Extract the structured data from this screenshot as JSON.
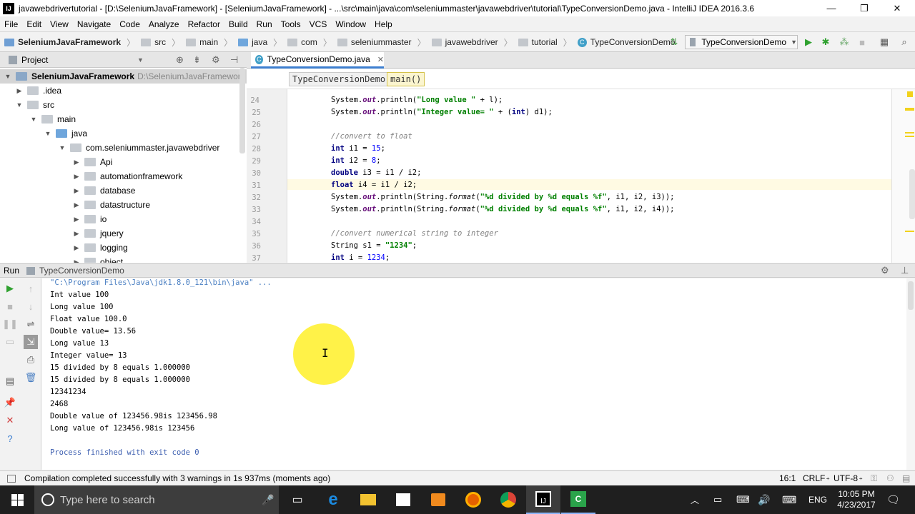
{
  "window": {
    "title": "javawebdrivertutorial - [D:\\SeleniumJavaFramework] - [SeleniumJavaFramework] - ...\\src\\main\\java\\com\\seleniummaster\\javawebdriver\\tutorial\\TypeConversionDemo.java - IntelliJ IDEA 2016.3.6",
    "app_icon_text": "IJ",
    "minimize": "—",
    "restore": "❐",
    "close": "✕"
  },
  "menu": [
    "File",
    "Edit",
    "View",
    "Navigate",
    "Code",
    "Analyze",
    "Refactor",
    "Build",
    "Run",
    "Tools",
    "VCS",
    "Window",
    "Help"
  ],
  "navbar": {
    "crumbs": [
      "SeleniumJavaFramework",
      "src",
      "main",
      "java",
      "com",
      "seleniummaster",
      "javawebdriver",
      "tutorial",
      "TypeConversionDemo"
    ],
    "run_config": "TypeConversionDemo"
  },
  "project_panel": {
    "title": "Project",
    "tree": [
      {
        "label": "SeleniumJavaFramework",
        "path": "D:\\SeleniumJavaFramework",
        "depth": 0,
        "expanded": true,
        "icon": "module"
      },
      {
        "label": ".idea",
        "depth": 1,
        "expanded": false,
        "icon": "folder"
      },
      {
        "label": "src",
        "depth": 1,
        "expanded": true,
        "icon": "folder"
      },
      {
        "label": "main",
        "depth": 2,
        "expanded": true,
        "icon": "folder"
      },
      {
        "label": "java",
        "depth": 3,
        "expanded": true,
        "icon": "source-folder"
      },
      {
        "label": "com.seleniummaster.javawebdriver",
        "depth": 4,
        "expanded": true,
        "icon": "package"
      },
      {
        "label": "Api",
        "depth": 5,
        "expanded": false,
        "icon": "package"
      },
      {
        "label": "automationframework",
        "depth": 5,
        "expanded": false,
        "icon": "package"
      },
      {
        "label": "database",
        "depth": 5,
        "expanded": false,
        "icon": "package"
      },
      {
        "label": "datastructure",
        "depth": 5,
        "expanded": false,
        "icon": "package"
      },
      {
        "label": "io",
        "depth": 5,
        "expanded": false,
        "icon": "package"
      },
      {
        "label": "jquery",
        "depth": 5,
        "expanded": false,
        "icon": "package"
      },
      {
        "label": "logging",
        "depth": 5,
        "expanded": false,
        "icon": "package"
      },
      {
        "label": "object",
        "depth": 5,
        "expanded": false,
        "icon": "package"
      }
    ]
  },
  "editor": {
    "tab_label": "TypeConversionDemo.java",
    "breadcrumbs": [
      "TypeConversionDemo",
      "main()"
    ],
    "lines": [
      {
        "n": "",
        "html": "        //..."
      },
      {
        "n": "24",
        "text": "System.out.println(\"Long value \" + l);"
      },
      {
        "n": "25",
        "text": "System.out.println(\"Integer value= \" + (int) d1);"
      },
      {
        "n": "26",
        "text": ""
      },
      {
        "n": "27",
        "text": "//convert to float"
      },
      {
        "n": "28",
        "text": "int i1 = 15;"
      },
      {
        "n": "29",
        "text": "int i2 = 8;"
      },
      {
        "n": "30",
        "text": "double i3 = i1 / i2;"
      },
      {
        "n": "31",
        "text": "float i4 = i1 / i2;"
      },
      {
        "n": "32",
        "text": "System.out.println(String.format(\"%d divided by %d equals %f\", i1, i2, i3));"
      },
      {
        "n": "33",
        "text": "System.out.println(String.format(\"%d divided by %d equals %f\", i1, i2, i4));"
      },
      {
        "n": "34",
        "text": ""
      },
      {
        "n": "35",
        "text": "//convert numerical string to integer"
      },
      {
        "n": "36",
        "text": "String s1 = \"1234\";"
      },
      {
        "n": "37",
        "text": "int i = 1234;"
      }
    ]
  },
  "run_panel": {
    "label": "Run",
    "config": "TypeConversionDemo",
    "output": [
      "\"C:\\Program Files\\Java\\jdk1.8.0_121\\bin\\java\" ...",
      "Int value 100",
      "Long value 100",
      "Float value 100.0",
      "Double value= 13.56",
      "Long value 13",
      "Integer value= 13",
      "15 divided by 8 equals 1.000000",
      "15 divided by 8 equals 1.000000",
      "12341234",
      "2468",
      "Double value of 123456.98is 123456.98",
      "Long value of 123456.98is 123456",
      "",
      "Process finished with exit code 0"
    ]
  },
  "status": {
    "message": "Compilation completed successfully with 3 warnings in 1s 937ms (moments ago)",
    "position": "16:1",
    "line_sep": "CRLF",
    "encoding": "UTF-8"
  },
  "taskbar": {
    "search_placeholder": "Type here to search",
    "language": "ENG",
    "time": "10:05 PM",
    "date": "4/23/2017"
  },
  "colors": {
    "accent": "#3d7fd0",
    "keyword": "#000080",
    "string": "#008000",
    "comment": "#808080",
    "highlight": "#fff028"
  }
}
